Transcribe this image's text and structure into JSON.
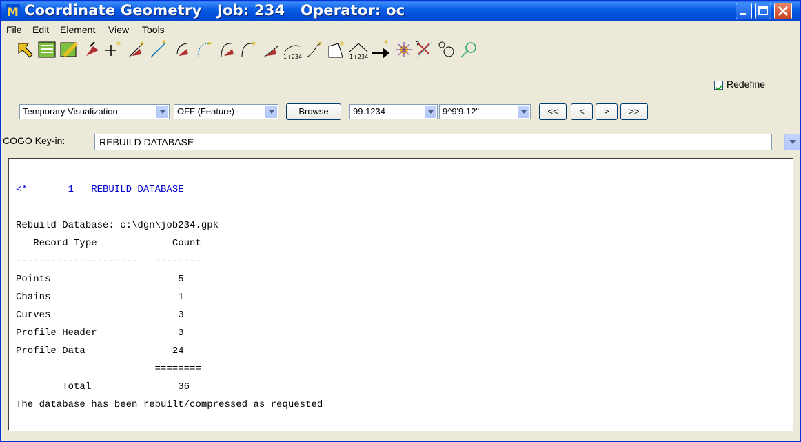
{
  "window": {
    "title": "Coordinate Geometry   Job: 234   Operator: oc",
    "icons": [
      "app-icon",
      "minimize-icon",
      "maximize-icon",
      "close-icon"
    ]
  },
  "menu": [
    "File",
    "Edit",
    "Element",
    "View",
    "Tools"
  ],
  "toolbar": {
    "redefine_label": "Redefine",
    "redefine_checked": true
  },
  "controls": {
    "visualization": "Temporary Visualization",
    "feature": "OFF (Feature)",
    "browse_label": "Browse",
    "value1": "99.1234",
    "value2": "9^9'9.12\"",
    "nav": [
      "<<",
      "<",
      ">",
      ">>"
    ]
  },
  "keyin": {
    "label": "COGO Key-in:",
    "value": "REBUILD DATABASE"
  },
  "output": {
    "lines": [
      "<*       1   REBUILD DATABASE",
      "",
      "Rebuild Database: c:\\dgn\\job234.gpk",
      "   Record Type             Count",
      "---------------------   --------",
      "Points                      5",
      "Chains                      1",
      "Curves                      3",
      "Profile Header              3",
      "Profile Data               24",
      "                        ========",
      "        Total               36",
      "The database has been rebuilt/compressed as requested"
    ]
  },
  "colors": {
    "title_blue": "#0450d8",
    "output_blue": "#0000d0"
  }
}
